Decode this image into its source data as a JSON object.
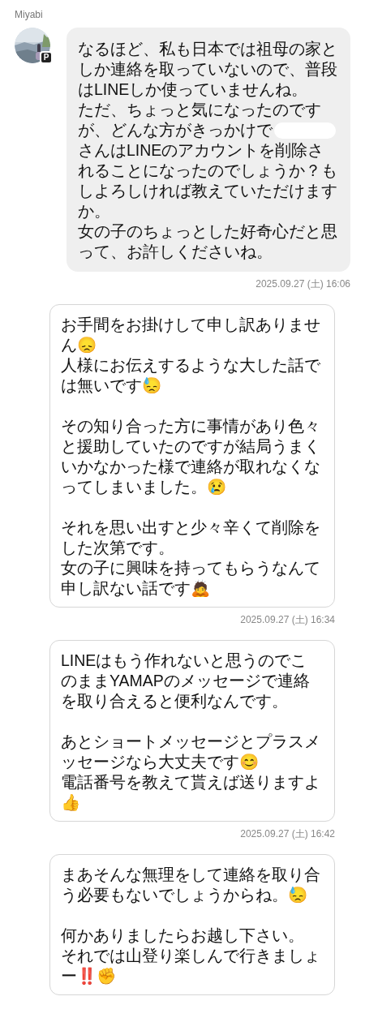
{
  "messages": [
    {
      "kind": "incoming",
      "sender": "Miyabi",
      "avatar": {
        "badge": "P"
      },
      "paragraphs": [
        [
          {
            "text": "なるほど、私も日本では祖母の家と"
          },
          {
            "text": "しか連絡を取っていないので、普段"
          },
          {
            "text": "はLINEしか使っていませんね。"
          },
          {
            "text": "ただ、ちょっと気になったのです"
          },
          {
            "text": "が、どんな方がきっかけで",
            "redacted": true
          },
          {
            "text": "さんはLINEのアカウントを削除さ"
          },
          {
            "text": "れることになったのでしょうか？も"
          },
          {
            "text": "しよろしければ教えていただけます"
          },
          {
            "text": "か。"
          },
          {
            "text": "女の子のちょっとした好奇心だと思"
          },
          {
            "text": "って、お許しくださいね。"
          }
        ]
      ],
      "timestamp": "2025.09.27 (土) 16:06"
    },
    {
      "kind": "outgoing",
      "paragraphs": [
        [
          {
            "text": "お手間をお掛けして申し訳ありませ"
          },
          {
            "text": "ん😞"
          },
          {
            "text": "人様にお伝えするような大した話で"
          },
          {
            "text": "は無いです😓"
          }
        ],
        [
          {
            "text": "その知り合った方に事情があり色々"
          },
          {
            "text": "と援助していたのですが結局うまく"
          },
          {
            "text": "いかなかった様で連絡が取れなくな"
          },
          {
            "text": "ってしまいました。😢"
          }
        ],
        [
          {
            "text": "それを思い出すと少々辛くて削除を"
          },
          {
            "text": "した次第です。"
          },
          {
            "text": "女の子に興味を持ってもらうなんて"
          },
          {
            "text": "申し訳ない話です🙇"
          }
        ]
      ],
      "timestamp": "2025.09.27 (土) 16:34"
    },
    {
      "kind": "outgoing",
      "paragraphs": [
        [
          {
            "text": "LINEはもう作れないと思うのでこ"
          },
          {
            "text": "のままYAMAPのメッセージで連絡"
          },
          {
            "text": "を取り合えると便利なんです。"
          }
        ],
        [
          {
            "text": "あとショートメッセージとプラスメ"
          },
          {
            "text": "ッセージなら大丈夫です😊"
          },
          {
            "text": "電話番号を教えて貰えば送りますよ"
          },
          {
            "text": "👍"
          }
        ]
      ],
      "timestamp": "2025.09.27 (土) 16:42"
    },
    {
      "kind": "outgoing",
      "paragraphs": [
        [
          {
            "text": "まあそんな無理をして連絡を取り合"
          },
          {
            "text": "う必要もないでしょうからね。😓"
          }
        ],
        [
          {
            "text": "何かありましたらお越し下さい。"
          },
          {
            "text": "それでは山登り楽しんで行きましょ"
          },
          {
            "text": "ー‼️✊"
          }
        ]
      ]
    }
  ]
}
